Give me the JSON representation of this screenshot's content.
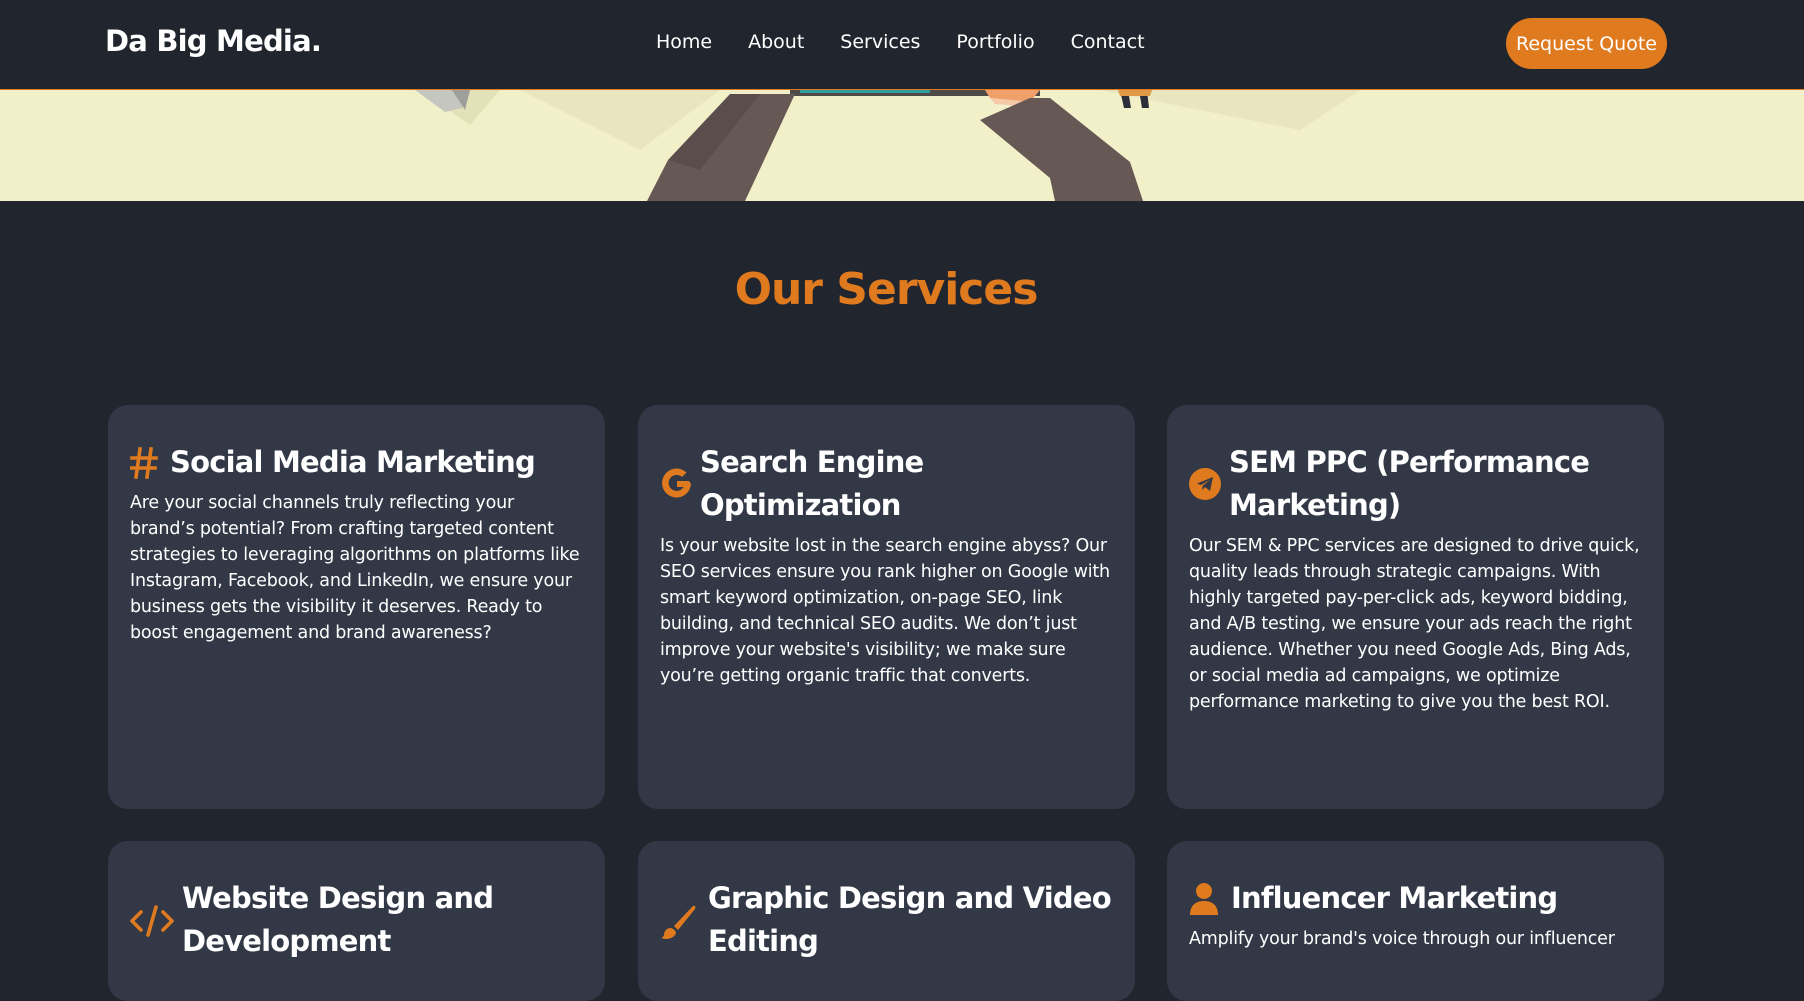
{
  "nav": {
    "brand": "Da Big Media.",
    "links": [
      "Home",
      "About",
      "Services",
      "Portfolio",
      "Contact"
    ],
    "cta": "Request Quote"
  },
  "services": {
    "title": "Our Services",
    "cards": [
      {
        "icon": "hashtag-icon",
        "title": "Social Media Marketing",
        "text": "Are your social channels truly reflecting your brand’s potential? From crafting targeted content strategies to leveraging algorithms on platforms like Instagram, Facebook, and LinkedIn, we ensure your business gets the visibility it deserves. Ready to boost engagement and brand awareness?"
      },
      {
        "icon": "google-icon",
        "title": "Search Engine Optimization",
        "text": "Is your website lost in the search engine abyss? Our SEO services ensure you rank higher on Google with smart keyword optimization, on-page SEO, link building, and technical SEO audits. We don’t just improve your website's visibility; we make sure you’re getting organic traffic that converts."
      },
      {
        "icon": "telegram-icon",
        "title": "SEM PPC (Performance Marketing)",
        "text": "Our SEM & PPC services are designed to drive quick, quality leads through strategic campaigns. With highly targeted pay-per-click ads, keyword bidding, and A/B testing, we ensure your ads reach the right audience. Whether you need Google Ads, Bing Ads, or social media ad campaigns, we optimize performance marketing to give you the best ROI."
      },
      {
        "icon": "code-icon",
        "title": "Website Design and Development",
        "text": ""
      },
      {
        "icon": "paintbrush-icon",
        "title": "Graphic Design and Video Editing",
        "text": ""
      },
      {
        "icon": "user-icon",
        "title": "Influencer Marketing",
        "text": "Amplify your brand's voice through our influencer"
      }
    ]
  },
  "colors": {
    "background": "#21252e",
    "card": "#323846",
    "accent": "#e07a1f",
    "hero": "#f2f0c9"
  }
}
